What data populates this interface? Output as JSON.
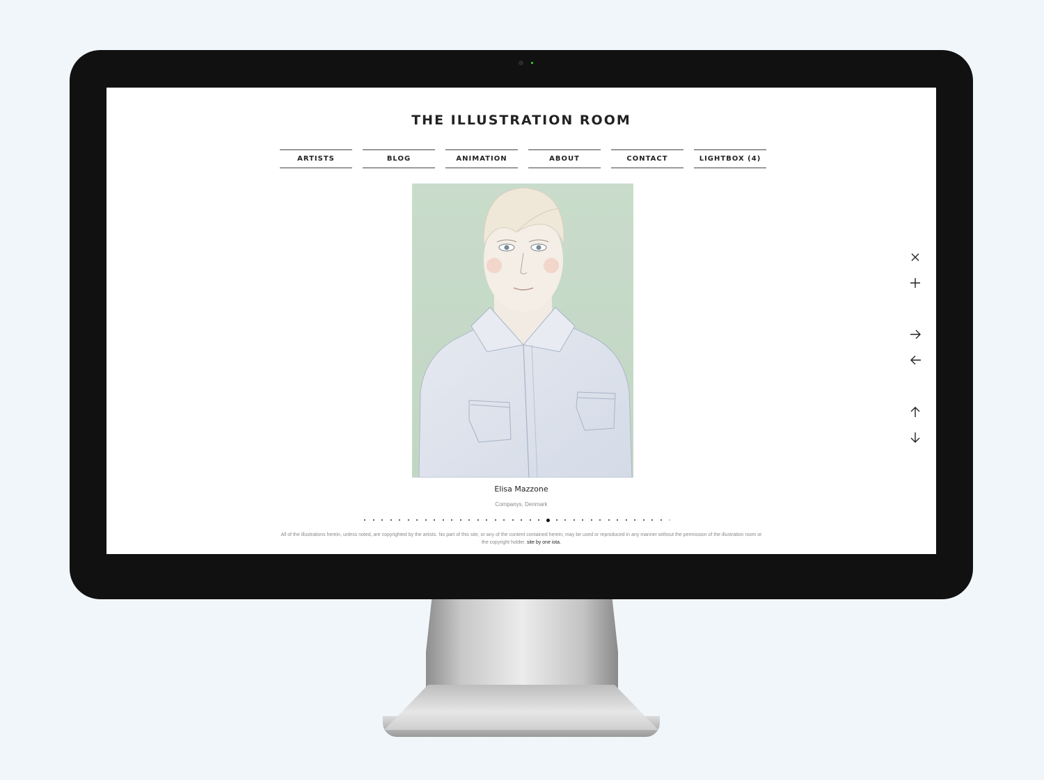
{
  "site": {
    "title": "THE ILLUSTRATION ROOM",
    "nav": [
      {
        "label": "ARTISTS"
      },
      {
        "label": "BLOG"
      },
      {
        "label": "ANIMATION"
      },
      {
        "label": "ABOUT"
      },
      {
        "label": "CONTACT"
      },
      {
        "label": "LIGHTBOX (4)"
      }
    ]
  },
  "artwork": {
    "artist_name": "Elisa Mazzone",
    "client_location": "Companys, Denmark",
    "slides_total": 36,
    "slide_active": 22
  },
  "controls": [
    {
      "icon": "close-icon"
    },
    {
      "icon": "plus-icon"
    },
    {
      "icon": "arrow-right-icon"
    },
    {
      "icon": "arrow-left-icon"
    },
    {
      "icon": "arrow-up-icon"
    },
    {
      "icon": "arrow-down-icon"
    }
  ],
  "footer": {
    "copyright": "All of the illustrations herein, unless noted, are copyrighted by the artists. No part of this site, or any of the content contained herein, may be used or reproduced in any manner without the permission of the illustration room or the copyright holder.",
    "credit": "site by one iota."
  },
  "colors": {
    "background": "#f1f6fa",
    "bezel": "#111111",
    "screen": "#ffffff",
    "artwork_bg": "#c8dac8",
    "text": "#222222"
  }
}
